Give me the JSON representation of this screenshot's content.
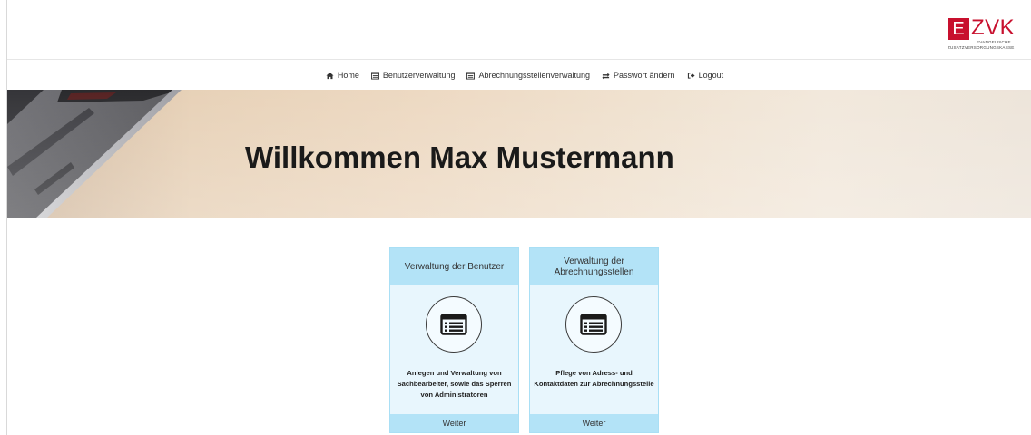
{
  "header": {
    "logo": {
      "letter": "E",
      "text": "ZVK",
      "sub1": "EVANGELISCHE",
      "sub2": "ZUSATZVERSORGUNGSKASSE"
    }
  },
  "nav": {
    "items": [
      {
        "label": "Home",
        "icon": "home-icon"
      },
      {
        "label": "Benutzerverwaltung",
        "icon": "list-icon"
      },
      {
        "label": "Abrechnungsstellenverwaltung",
        "icon": "list-icon"
      },
      {
        "label": "Passwort ändern",
        "icon": "exchange-icon"
      },
      {
        "label": "Logout",
        "icon": "logout-icon"
      }
    ]
  },
  "hero": {
    "title": "Willkommen Max Mustermann"
  },
  "cards": [
    {
      "title": "Verwaltung der Benutzer",
      "icon": "list-icon",
      "description": "Anlegen und Verwaltung von Sachbearbeiter, sowie das Sperren von Administratoren",
      "action": "Weiter"
    },
    {
      "title": "Verwaltung der Abrechnungsstellen",
      "icon": "list-icon",
      "description": "Pflege von Adress- und Kontaktdaten zur Abrechnungsstelle",
      "action": "Weiter"
    }
  ],
  "colors": {
    "brand": "#c8102e",
    "card_header": "#b3e3f7",
    "card_body": "#e8f6fd"
  }
}
